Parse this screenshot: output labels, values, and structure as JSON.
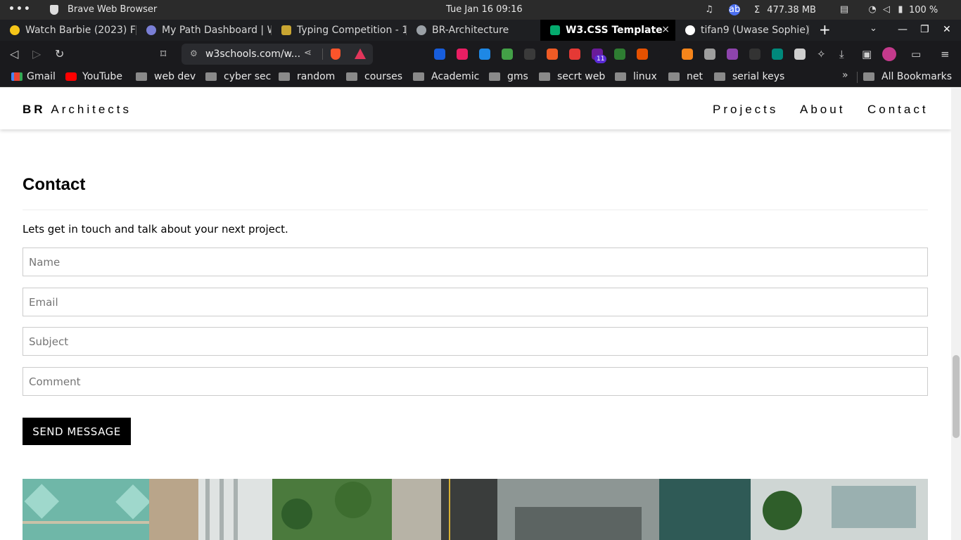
{
  "system": {
    "app_name": "Brave Web Browser",
    "clock": "Tue Jan 16  09:16",
    "memory": "477.38 MB",
    "memory_prefix": "Σ",
    "battery": "100 %",
    "tray_icons": [
      "music-note-icon",
      "user-avatar-icon",
      "clipboard-icon",
      "wifi-icon",
      "volume-muted-icon",
      "battery-icon"
    ]
  },
  "tabs": [
    {
      "label": "Watch Barbie (2023) Fu",
      "icon": "play-icon",
      "color": "#f5c518"
    },
    {
      "label": "My Path Dashboard | W",
      "icon": "w3schools-path-icon",
      "color": "#7a7fd6"
    },
    {
      "label": "Typing Competition - 1",
      "icon": "trophy-icon",
      "color": "#c9a632"
    },
    {
      "label": "BR-Architecture",
      "icon": "globe-icon",
      "color": "#9aa0a6"
    },
    {
      "label": "W3.CSS Template",
      "icon": "w3-icon",
      "color": "#04aa6d",
      "active": true
    },
    {
      "label": "tifan9 (Uwase Sophie)",
      "icon": "github-icon",
      "color": "#ffffff"
    }
  ],
  "tab_controls": {
    "new_tab": "+",
    "list": "⌄",
    "minimize": "—",
    "maximize": "❐",
    "close": "✕",
    "tab_close": "×"
  },
  "toolbar": {
    "url": "w3schools.com/w...",
    "back": "◁",
    "forward": "▷",
    "reload": "↻",
    "bookmark": "⌑"
  },
  "extensions": [
    {
      "name": "bitwarden-icon",
      "color": "#175ddc"
    },
    {
      "name": "grid-app-icon",
      "color": "#e91e63"
    },
    {
      "name": "fi-icon",
      "color": "#1e88e5"
    },
    {
      "name": "ext-colorful-icon",
      "color": "#43a047"
    },
    {
      "name": "json-icon",
      "color": "#3a3a3a"
    },
    {
      "name": "translate-icon",
      "color": "#ef5b25"
    },
    {
      "name": "media-icon",
      "color": "#e53935"
    },
    {
      "name": "purple-ext-icon",
      "color": "#6a1b9a",
      "badge": "11"
    },
    {
      "name": "robot-icon",
      "color": "#2e7d32"
    },
    {
      "name": "ext-orange-icon",
      "color": "#e65100"
    },
    {
      "name": "mute-tab-icon",
      "color": "#1a1a1d"
    },
    {
      "name": "metamask-icon",
      "color": "#f6851b"
    },
    {
      "name": "dots-ext-icon",
      "color": "#9e9e9e"
    },
    {
      "name": "gradient-ext-icon",
      "color": "#8e44ad"
    },
    {
      "name": "dark-ext-icon",
      "color": "#333333"
    },
    {
      "name": "m-ext-icon",
      "color": "#00897b"
    },
    {
      "name": "white-ext-icon",
      "color": "#cfcfcf"
    }
  ],
  "bookmarks": [
    {
      "label": "Gmail",
      "type": "gmail"
    },
    {
      "label": "YouTube",
      "type": "youtube"
    },
    {
      "label": "web dev",
      "type": "folder"
    },
    {
      "label": "cyber sec",
      "type": "folder"
    },
    {
      "label": "random",
      "type": "folder"
    },
    {
      "label": "courses",
      "type": "folder"
    },
    {
      "label": "Academic",
      "type": "folder"
    },
    {
      "label": "gms",
      "type": "folder"
    },
    {
      "label": "secrt web",
      "type": "folder"
    },
    {
      "label": "linux",
      "type": "folder"
    },
    {
      "label": "net",
      "type": "folder"
    },
    {
      "label": "serial keys",
      "type": "folder"
    }
  ],
  "bookmarks_more": "»",
  "all_bookmarks": "All Bookmarks",
  "site": {
    "brand_bold": "BR",
    "brand_rest": "Architects",
    "nav": [
      "Projects",
      "About",
      "Contact"
    ],
    "contact_title": "Contact",
    "lead": "Lets get in touch and talk about your next project.",
    "fields": [
      {
        "placeholder": "Name",
        "value": ""
      },
      {
        "placeholder": "Email",
        "value": ""
      },
      {
        "placeholder": "Subject",
        "value": ""
      },
      {
        "placeholder": "Comment",
        "value": ""
      }
    ],
    "send_label": "SEND MESSAGE"
  }
}
